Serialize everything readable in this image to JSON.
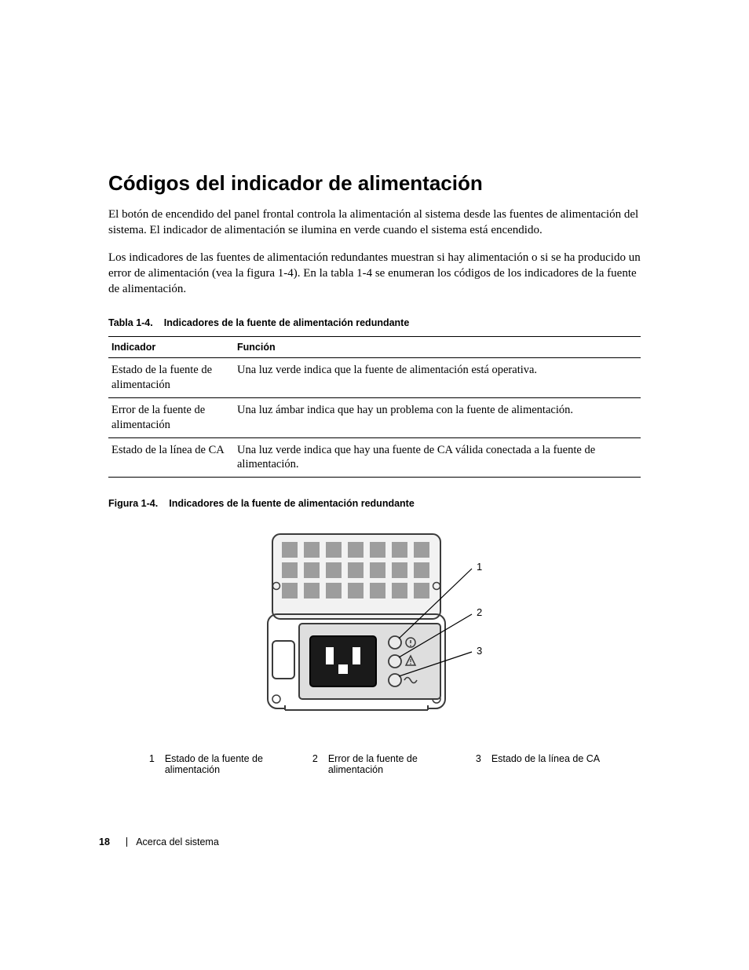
{
  "heading": "Códigos del indicador de alimentación",
  "para1": "El botón de encendido del panel frontal controla la alimentación al sistema desde las fuentes de alimentación del sistema. El indicador de alimentación se ilumina en verde cuando el sistema está encendido.",
  "para2": "Los indicadores de las fuentes de alimentación redundantes muestran si hay alimentación o si se ha producido un error de alimentación (vea la figura 1-4). En la tabla 1-4 se enumeran los códigos de los indicadores de la fuente de alimentación.",
  "table": {
    "caption_num": "Tabla 1-4.",
    "caption_text": "Indicadores de la fuente de alimentación redundante",
    "headers": {
      "col1": "Indicador",
      "col2": "Función"
    },
    "rows": [
      {
        "c1": "Estado de la fuente de alimentación",
        "c2": "Una luz verde indica que la fuente de alimentación está operativa."
      },
      {
        "c1": "Error de la fuente de alimentación",
        "c2": "Una luz ámbar indica que hay un problema con la fuente de alimentación."
      },
      {
        "c1": "Estado de la línea de CA",
        "c2": "Una luz verde indica que hay una fuente de CA válida conectada a la fuente de alimentación."
      }
    ]
  },
  "figure": {
    "caption_num": "Figura 1-4.",
    "caption_text": "Indicadores de la fuente de alimentación redundante",
    "callouts": {
      "c1": "1",
      "c2": "2",
      "c3": "3"
    }
  },
  "legend": {
    "items": [
      {
        "num": "1",
        "text": "Estado de la fuente de alimentación"
      },
      {
        "num": "2",
        "text": "Error de la fuente de alimentación"
      },
      {
        "num": "3",
        "text": "Estado de la línea de CA"
      }
    ]
  },
  "footer": {
    "page_number": "18",
    "section": "Acerca del sistema"
  }
}
